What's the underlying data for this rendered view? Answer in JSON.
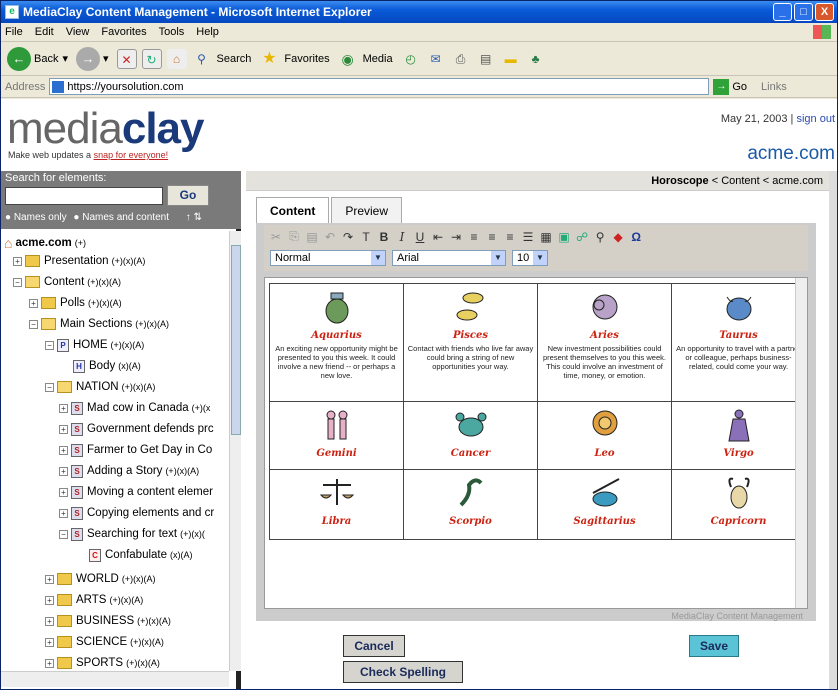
{
  "window": {
    "title": "MediaClay Content Management - Microsoft Internet Explorer",
    "min": "_",
    "max": "□",
    "close": "X"
  },
  "menu": [
    "File",
    "Edit",
    "View",
    "Favorites",
    "Tools",
    "Help"
  ],
  "toolbar": {
    "back": "Back",
    "search": "Search",
    "favorites": "Favorites",
    "media": "Media"
  },
  "address": {
    "label": "Address",
    "url": "https://yoursolution.com",
    "go": "Go",
    "links": "Links"
  },
  "header": {
    "logo_light": "media",
    "logo_bold": "clay",
    "tagline_pre": "Make web updates a ",
    "tagline_link": "snap for everyone!",
    "date": "May 21, 2003 |",
    "signout": "sign out",
    "site": "acme.com"
  },
  "search": {
    "label": "Search for elements:",
    "go": "Go",
    "opt1": "Names only",
    "opt2": "Names and content"
  },
  "tree": [
    {
      "label": "acme.com",
      "ops": "(+)"
    },
    {
      "label": "Presentation",
      "ops": "(+)(x)(A)"
    },
    {
      "label": "Content",
      "ops": "(+)(x)(A)"
    },
    {
      "label": "Polls",
      "ops": "(+)(x)(A)"
    },
    {
      "label": "Main Sections",
      "ops": "(+)(x)(A)"
    },
    {
      "label": "HOME",
      "ops": "(+)(x)(A)"
    },
    {
      "label": "Body",
      "ops": "(x)(A)"
    },
    {
      "label": "NATION",
      "ops": "(+)(x)(A)"
    },
    {
      "label": "Mad cow in Canada",
      "ops": "(+)(x"
    },
    {
      "label": "Government defends prc",
      "ops": ""
    },
    {
      "label": "Farmer to Get Day in Co",
      "ops": ""
    },
    {
      "label": "Adding a Story",
      "ops": "(+)(x)(A)"
    },
    {
      "label": "Moving a content elemer",
      "ops": ""
    },
    {
      "label": "Copying elements and cr",
      "ops": ""
    },
    {
      "label": "Searching for text",
      "ops": "(+)(x)("
    },
    {
      "label": "Confabulate",
      "ops": "(x)(A)"
    },
    {
      "label": "WORLD",
      "ops": "(+)(x)(A)"
    },
    {
      "label": "ARTS",
      "ops": "(+)(x)(A)"
    },
    {
      "label": "BUSINESS",
      "ops": "(+)(x)(A)"
    },
    {
      "label": "SCIENCE",
      "ops": "(+)(x)(A)"
    },
    {
      "label": "SPORTS",
      "ops": "(+)(x)(A)"
    }
  ],
  "crumbs": {
    "bold": "Horoscope",
    "rest": " < Content < acme.com"
  },
  "tabs": {
    "content": "Content",
    "preview": "Preview"
  },
  "editor": {
    "style": "Normal",
    "font": "Arial",
    "size": "10",
    "watermark": "MediaClay Content Management"
  },
  "signs": [
    {
      "name": "Aquarius",
      "desc": "An exciting new opportunity might be presented to you this week. It could involve a new friend -- or perhaps a new love."
    },
    {
      "name": "Pisces",
      "desc": "Contact with friends who live far away could bring a string of new opportunities your way."
    },
    {
      "name": "Aries",
      "desc": "New investment possibilities could present themselves to you this week. This could involve an investment of time, money, or emotion."
    },
    {
      "name": "Taurus",
      "desc": "An opportunity to travel with a partner or colleague, perhaps business-related, could come your way."
    },
    {
      "name": "Gemini",
      "desc": ""
    },
    {
      "name": "Cancer",
      "desc": ""
    },
    {
      "name": "Leo",
      "desc": ""
    },
    {
      "name": "Virgo",
      "desc": ""
    },
    {
      "name": "Libra",
      "desc": ""
    },
    {
      "name": "Scorpio",
      "desc": ""
    },
    {
      "name": "Sagittarius",
      "desc": ""
    },
    {
      "name": "Capricorn",
      "desc": ""
    }
  ],
  "buttons": {
    "cancel": "Cancel",
    "spell": "Check Spelling",
    "save": "Save"
  }
}
